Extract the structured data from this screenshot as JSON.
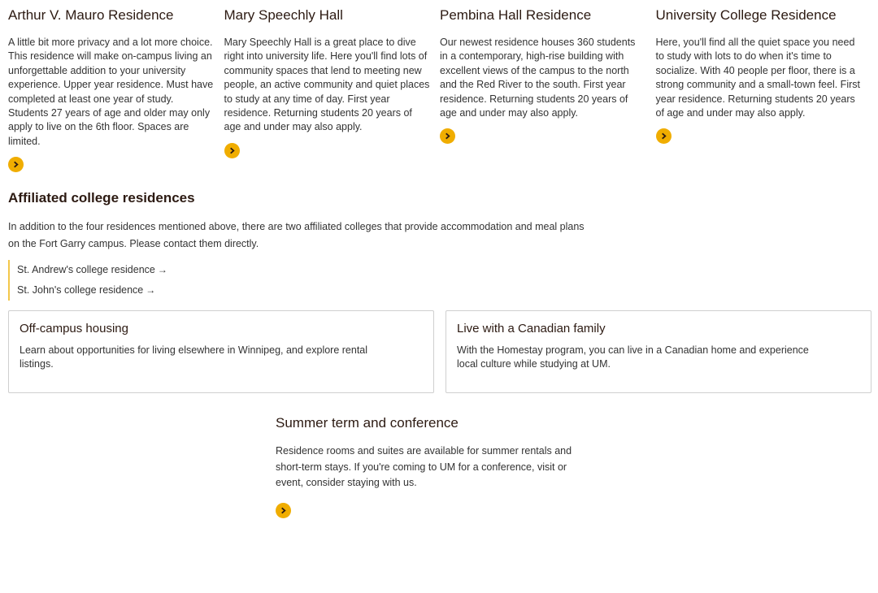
{
  "residences": [
    {
      "title": "Arthur V. Mauro Residence",
      "description": "A little bit more privacy and a lot more choice. This residence will make on-campus living an unforgettable addition to your university experience. Upper year residence. Must have completed at least one year of study. Students 27 years of age and older may only apply to live on the 6th floor. Spaces are limited."
    },
    {
      "title": "Mary Speechly Hall",
      "description": "Mary Speechly Hall is a great place to dive right into university life. Here you'll find lots of community spaces that lend to meeting new people, an active community and quiet places to study at any time of day. First year residence. Returning students 20 years of age and under may also apply."
    },
    {
      "title": "Pembina Hall Residence",
      "description": "Our newest residence houses 360 students in a contemporary, high-rise building with excellent views of the campus to the north and the Red River to the south. First year residence. Returning students 20 years of age and under may also apply."
    },
    {
      "title": "University College Residence",
      "description": "Here, you'll find all the quiet space you need to study with lots to do when it's time to socialize. With 40 people per floor, there is a strong community and a small-town feel. First year residence. Returning students 20 years of age and under may also apply."
    }
  ],
  "affiliated": {
    "title": "Affiliated college residences",
    "text": "In addition to the four residences mentioned above, there are two affiliated colleges that provide accommodation and meal plans on the Fort Garry campus. Please contact them directly.",
    "links": [
      "St. Andrew's college residence",
      "St. John's college residence"
    ],
    "arrow": "→"
  },
  "boxes": {
    "offcampus": {
      "title": "Off-campus housing",
      "text": "Learn about opportunities for living elsewhere in Winnipeg, and explore rental listings."
    },
    "homestay": {
      "title": "Live with a Canadian family",
      "text": "With the Homestay program, you can live in a Canadian home and experience local culture while studying at UM."
    }
  },
  "summer": {
    "title": "Summer term and conference",
    "text": "Residence rooms and suites are available for summer rentals and short-term stays. If you're coming to UM for a conference, visit or event, consider staying with us."
  },
  "colors": {
    "accent": "#f0ad00",
    "heading": "#2c1a12",
    "border": "#cfcfcf"
  }
}
